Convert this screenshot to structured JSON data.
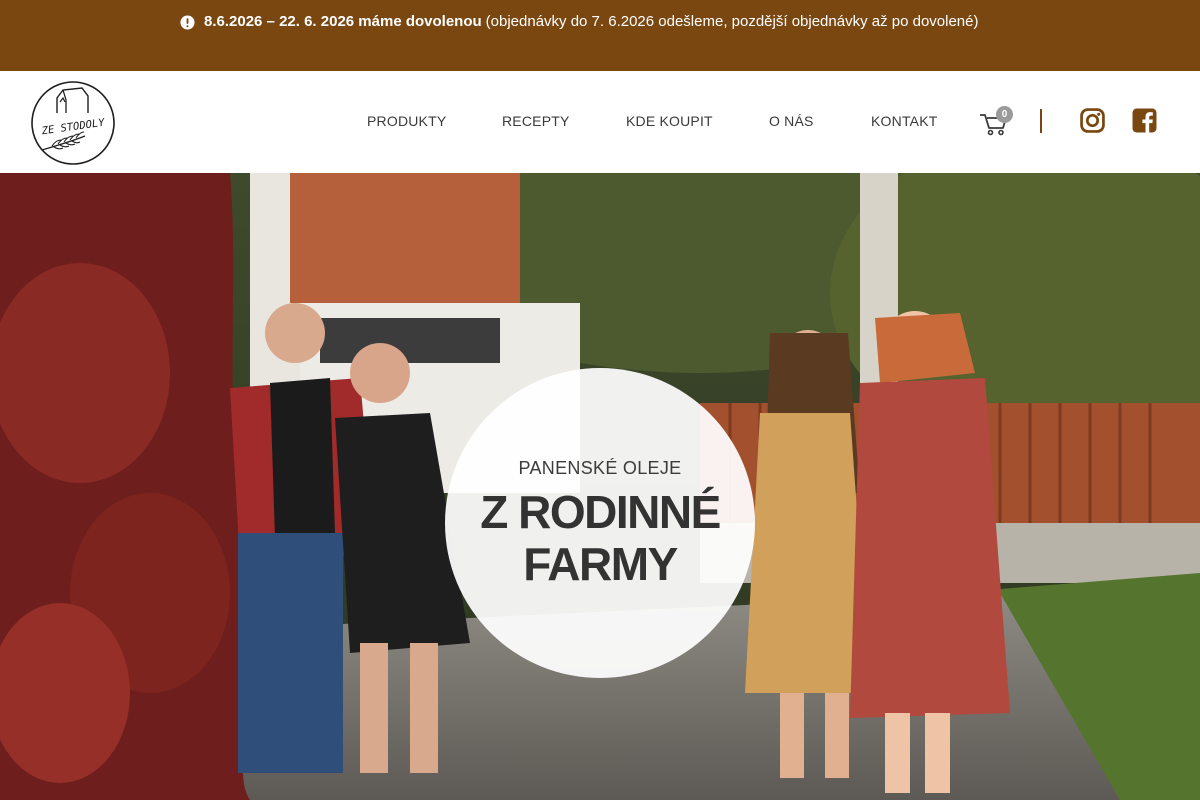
{
  "notice": {
    "icon": "exclamation-circle-icon",
    "dates": "8.6.2026 – 22. 6. 2026 máme dovolenou",
    "details": "(objednávky do 7. 6.2026 odešleme, pozdější objednávky až po dovolené)"
  },
  "logo": {
    "text": "ZE STODOLY",
    "icon": "barn-logo-icon"
  },
  "nav": {
    "items": [
      {
        "label": "PRODUKTY"
      },
      {
        "label": "RECEPTY"
      },
      {
        "label": "KDE KOUPIT"
      },
      {
        "label": "O NÁS"
      },
      {
        "label": "KONTAKT"
      }
    ],
    "cart_count": "0",
    "cart_icon": "shopping-cart-icon",
    "social": [
      "instagram-icon",
      "facebook-icon"
    ]
  },
  "hero": {
    "subtitle": "PANENSKÉ OLEJE",
    "title_line1": "Z RODINNÉ",
    "title_line2": "FARMY"
  },
  "colors": {
    "brand_brown": "#7a4711",
    "text_dark": "#333333",
    "badge_gray": "#9a9a9a"
  }
}
